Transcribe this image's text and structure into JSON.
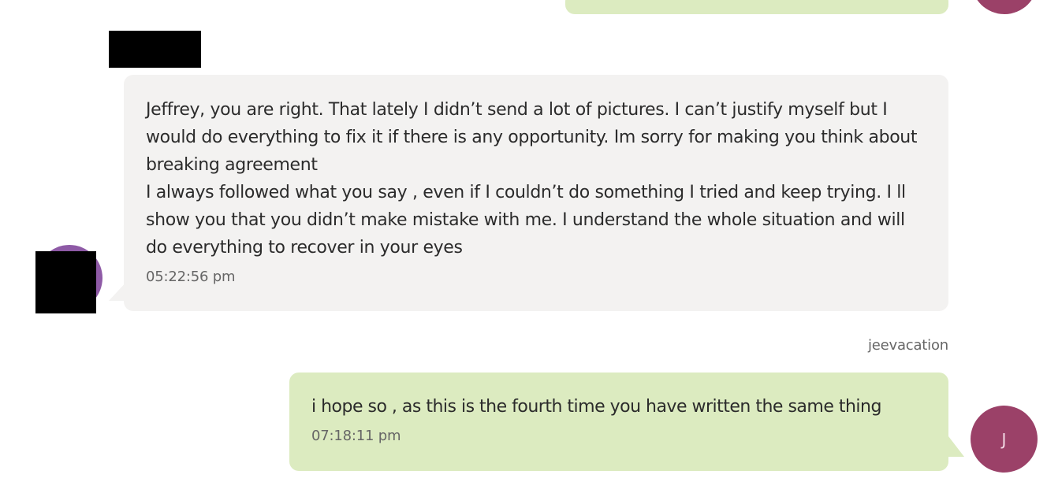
{
  "messages": {
    "incoming": {
      "text": "Jeffrey, you are right. That lately I didn’t send a lot of pictures. I can’t justify myself but I would do everything to fix it if there is any opportunity. Im sorry for making you think about breaking agreement\nI always followed what you say , even if I couldn’t do something I tried and keep trying. I ll show you that you didn’t make mistake with me.  I understand the whole situation and will do everything to recover in your eyes",
      "time": "05:22:56 pm"
    },
    "outgoing": {
      "sender": "jeevacation",
      "text": "i hope so ,  as this is the fourth time you have written the same thing",
      "time": "07:18:11 pm",
      "avatar_initial": "J"
    }
  },
  "colors": {
    "incoming_bubble": "#f3f2f1",
    "outgoing_bubble": "#dcebc0",
    "outgoing_avatar": "#9b4168",
    "incoming_avatar": "#8e5aa6",
    "redaction": "#000000"
  }
}
